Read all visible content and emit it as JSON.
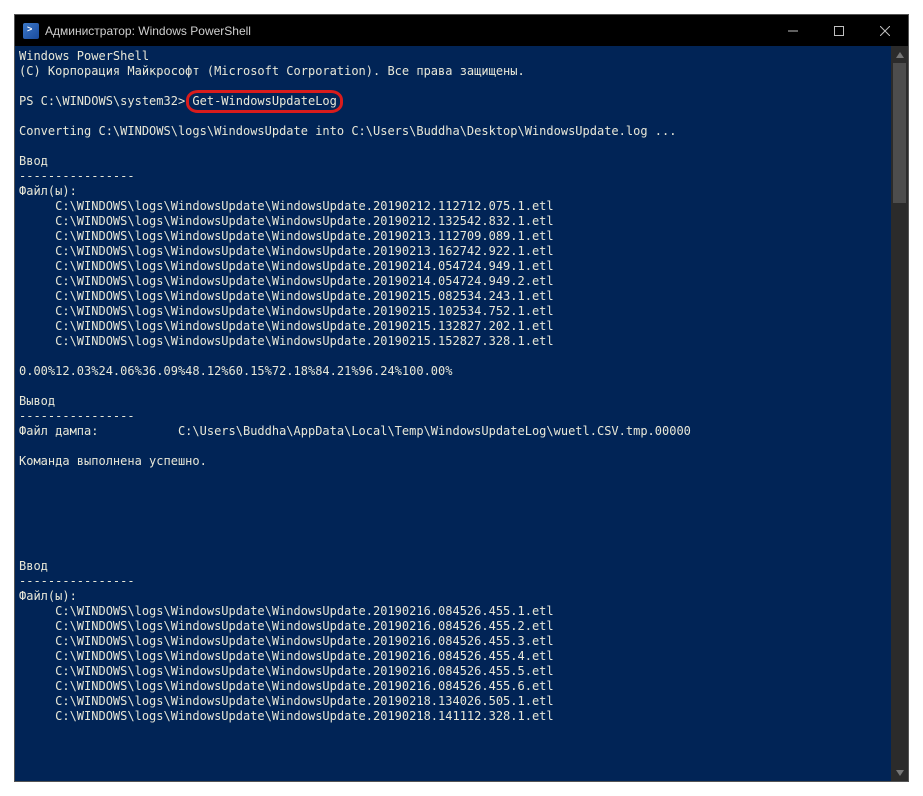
{
  "window": {
    "title": "Администратор: Windows PowerShell"
  },
  "terminal": {
    "header1": "Windows PowerShell",
    "header2": "(C) Корпорация Майкрософт (Microsoft Corporation). Все права защищены.",
    "prompt": "PS C:\\WINDOWS\\system32> ",
    "command": "Get-WindowsUpdateLog",
    "converting": "Converting C:\\WINDOWS\\logs\\WindowsUpdate into C:\\Users\\Buddha\\Desktop\\WindowsUpdate.log ...",
    "input_label": "Ввод",
    "input_dashes": "----------------",
    "files_label": "Файл(ы):",
    "files1": [
      "     C:\\WINDOWS\\logs\\WindowsUpdate\\WindowsUpdate.20190212.112712.075.1.etl",
      "     C:\\WINDOWS\\logs\\WindowsUpdate\\WindowsUpdate.20190212.132542.832.1.etl",
      "     C:\\WINDOWS\\logs\\WindowsUpdate\\WindowsUpdate.20190213.112709.089.1.etl",
      "     C:\\WINDOWS\\logs\\WindowsUpdate\\WindowsUpdate.20190213.162742.922.1.etl",
      "     C:\\WINDOWS\\logs\\WindowsUpdate\\WindowsUpdate.20190214.054724.949.1.etl",
      "     C:\\WINDOWS\\logs\\WindowsUpdate\\WindowsUpdate.20190214.054724.949.2.etl",
      "     C:\\WINDOWS\\logs\\WindowsUpdate\\WindowsUpdate.20190215.082534.243.1.etl",
      "     C:\\WINDOWS\\logs\\WindowsUpdate\\WindowsUpdate.20190215.102534.752.1.etl",
      "     C:\\WINDOWS\\logs\\WindowsUpdate\\WindowsUpdate.20190215.132827.202.1.etl",
      "     C:\\WINDOWS\\logs\\WindowsUpdate\\WindowsUpdate.20190215.152827.328.1.etl"
    ],
    "progress": "0.00%12.03%24.06%36.09%48.12%60.15%72.18%84.21%96.24%100.00%",
    "output_label": "Вывод",
    "output_dashes": "----------------",
    "dump_file": "Файл дампа:           C:\\Users\\Buddha\\AppData\\Local\\Temp\\WindowsUpdateLog\\wuetl.CSV.tmp.00000",
    "success": "Команда выполнена успешно.",
    "input_label2": "Ввод",
    "input_dashes2": "----------------",
    "files_label2": "Файл(ы):",
    "files2": [
      "     C:\\WINDOWS\\logs\\WindowsUpdate\\WindowsUpdate.20190216.084526.455.1.etl",
      "     C:\\WINDOWS\\logs\\WindowsUpdate\\WindowsUpdate.20190216.084526.455.2.etl",
      "     C:\\WINDOWS\\logs\\WindowsUpdate\\WindowsUpdate.20190216.084526.455.3.etl",
      "     C:\\WINDOWS\\logs\\WindowsUpdate\\WindowsUpdate.20190216.084526.455.4.etl",
      "     C:\\WINDOWS\\logs\\WindowsUpdate\\WindowsUpdate.20190216.084526.455.5.etl",
      "     C:\\WINDOWS\\logs\\WindowsUpdate\\WindowsUpdate.20190216.084526.455.6.etl",
      "     C:\\WINDOWS\\logs\\WindowsUpdate\\WindowsUpdate.20190218.134026.505.1.etl",
      "     C:\\WINDOWS\\logs\\WindowsUpdate\\WindowsUpdate.20190218.141112.328.1.etl"
    ]
  }
}
